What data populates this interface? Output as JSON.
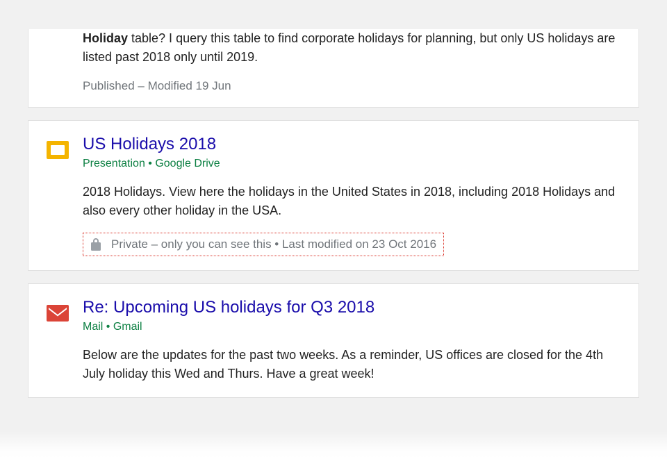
{
  "results": [
    {
      "snippet_bold": "Holiday",
      "snippet_rest": " table? I query this table to find corporate holidays for planning, but only US holidays are listed past 2018 only until 2019.",
      "meta": "Published – Modified 19 Jun"
    },
    {
      "title": "US Holidays 2018",
      "subtitle": "Presentation • Google Drive",
      "snippet": "2018 Holidays. View here the holidays in the United States in 2018, including 2018 Holidays and also every other holiday in the USA.",
      "privacy": "Private – only you can see this • Last modified on 23 Oct 2016"
    },
    {
      "title": "Re: Upcoming US holidays for Q3 2018",
      "subtitle": "Mail • Gmail",
      "snippet": "Below are the updates for the past two weeks. As a reminder, US offices are closed for the 4th July holiday this Wed and Thurs. Have a great week!"
    }
  ]
}
